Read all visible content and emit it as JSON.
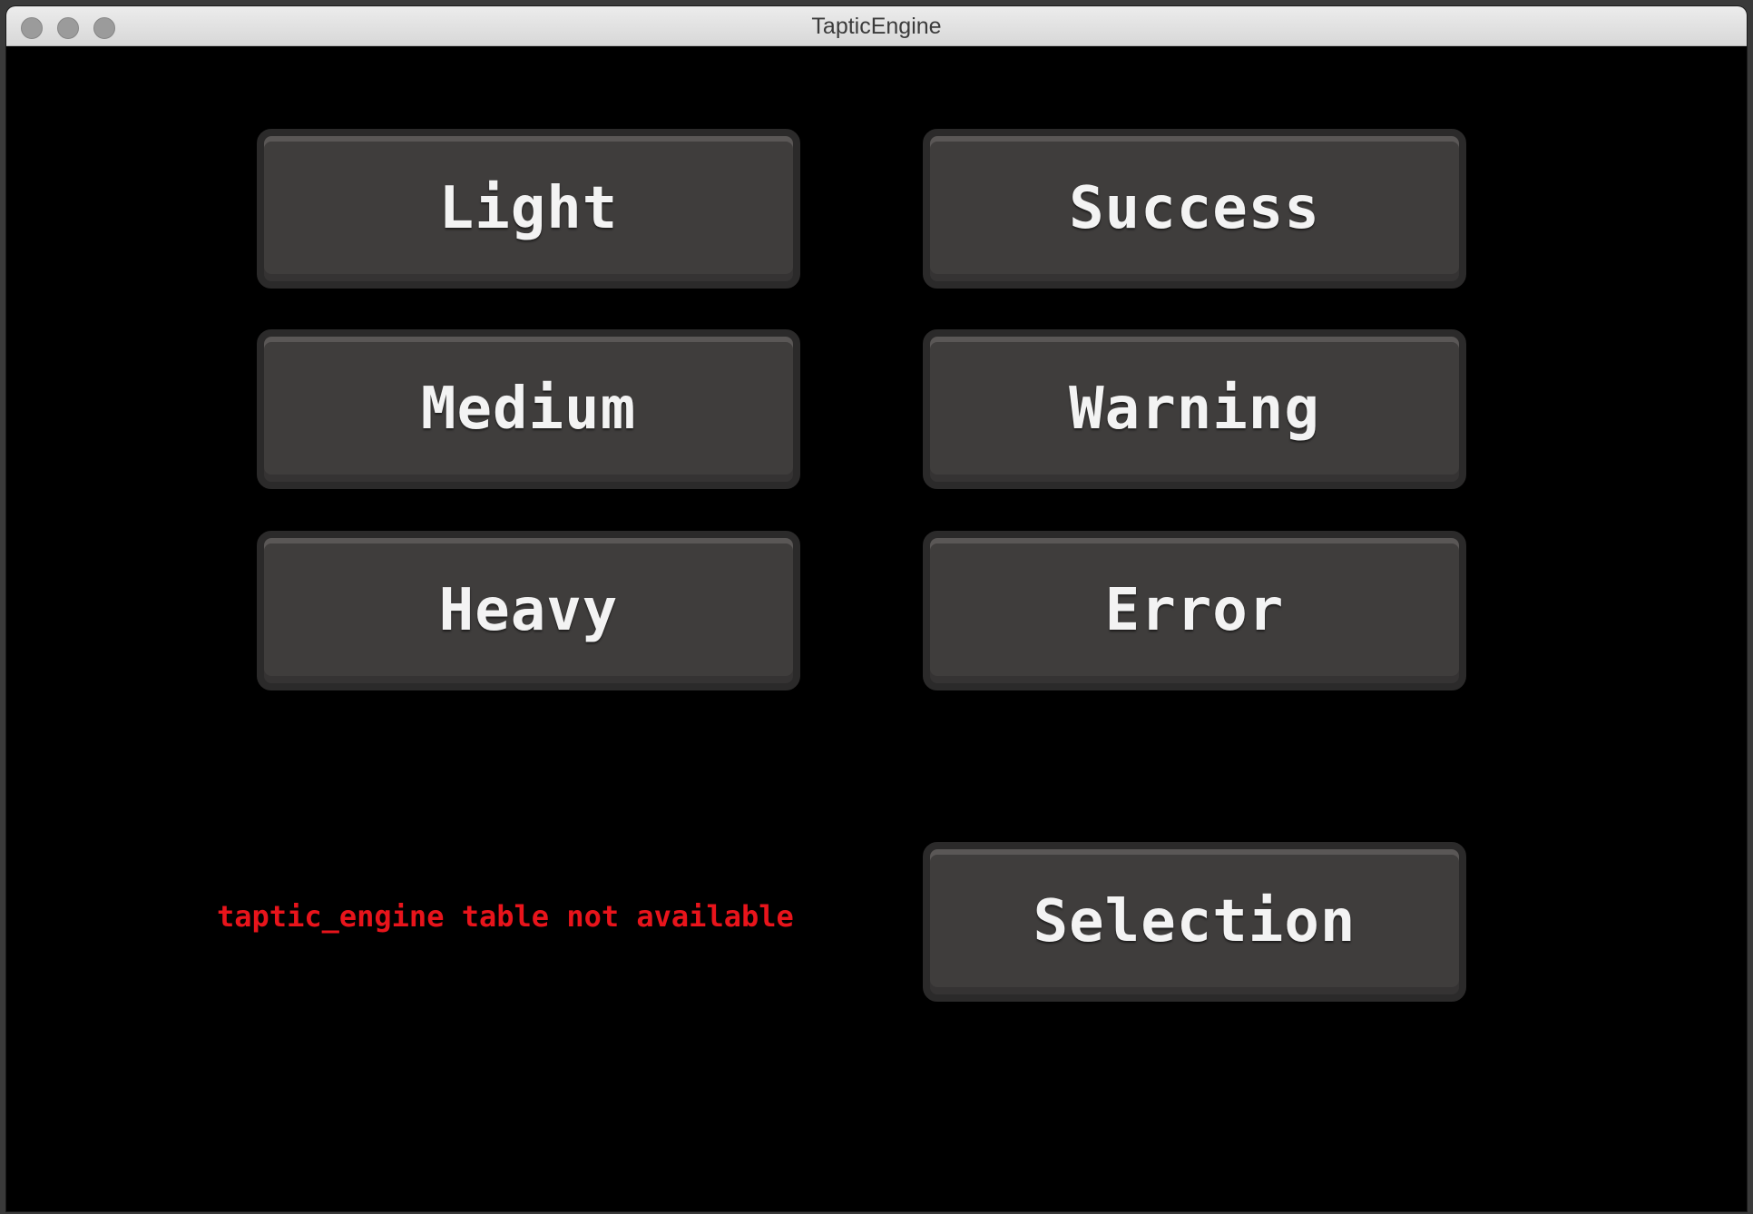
{
  "window": {
    "title": "TapticEngine"
  },
  "impact_buttons": {
    "light": "Light",
    "medium": "Medium",
    "heavy": "Heavy"
  },
  "notification_buttons": {
    "success": "Success",
    "warning": "Warning",
    "error": "Error"
  },
  "selection_button": {
    "label": "Selection"
  },
  "status": {
    "message": "taptic_engine table not available",
    "color": "#e8141b"
  },
  "colors": {
    "background": "#000000",
    "button_face": "#3f3d3c",
    "button_border": "#2b2a2a",
    "button_text": "#f3f3f3"
  }
}
